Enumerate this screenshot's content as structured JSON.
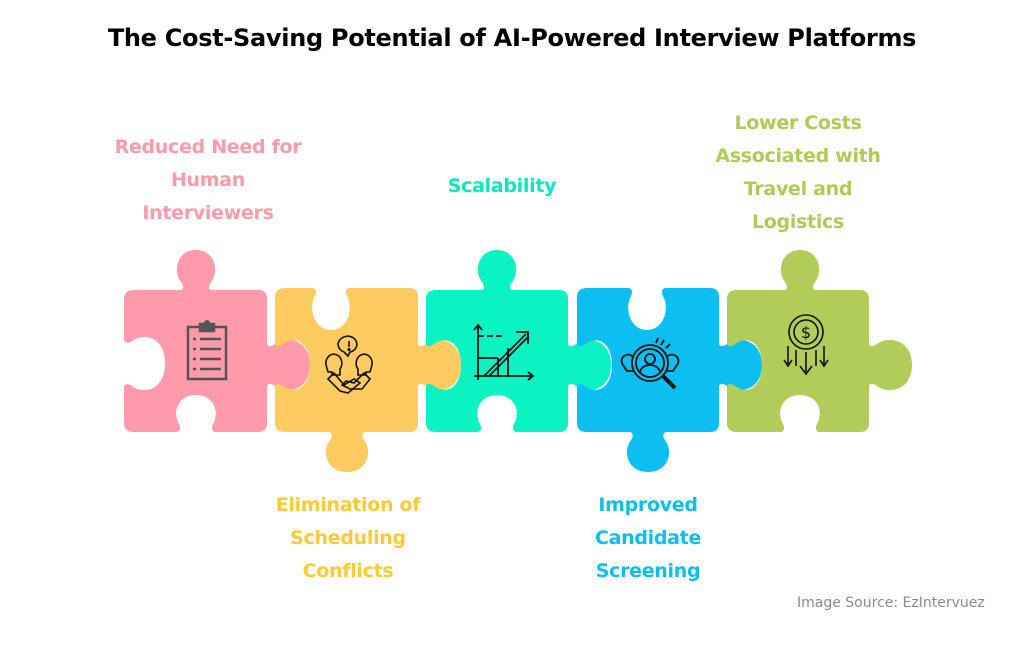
{
  "title": "The Cost-Saving Potential of AI-Powered Interview Platforms",
  "pieces": [
    {
      "label_lines": [
        "Reduced Need for",
        "Human",
        "Interviewers"
      ],
      "color": "#FF9AAB",
      "icon": "clipboard-icon",
      "label_position": "top"
    },
    {
      "label_lines": [
        "Elimination of",
        "Scheduling",
        "Conflicts"
      ],
      "color": "#FDCB5F",
      "icon": "handshake-team-icon",
      "label_position": "bottom"
    },
    {
      "label_lines": [
        "Scalability"
      ],
      "color": "#0BF2C3",
      "icon": "growth-chart-icon",
      "label_position": "top"
    },
    {
      "label_lines": [
        "Improved",
        "Candidate",
        "Screening"
      ],
      "color": "#0DBEF0",
      "icon": "candidate-search-icon",
      "label_position": "bottom"
    },
    {
      "label_lines": [
        "Lower Costs",
        "Associated with",
        "Travel and",
        "Logistics"
      ],
      "color": "#B2CC5A",
      "icon": "dollar-down-icon",
      "label_position": "top"
    }
  ],
  "label_colors": [
    "#FF9AAB",
    "#FDC934",
    "#0BE8BE",
    "#0DBEF0",
    "#AECB57"
  ],
  "source": "Image Source: EzIntervuez"
}
